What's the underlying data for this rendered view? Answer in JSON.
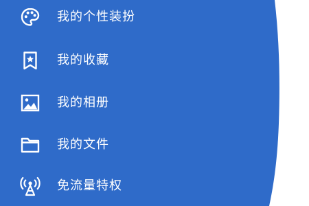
{
  "theme": {
    "drawer_color": "#2f6bc9",
    "background_color": "#ffffff",
    "text_color": "#ffffff"
  },
  "menu": {
    "items": [
      {
        "label": "我的个性装扮",
        "icon": "palette-icon"
      },
      {
        "label": "我的收藏",
        "icon": "bookmark-star-icon"
      },
      {
        "label": "我的相册",
        "icon": "image-icon"
      },
      {
        "label": "我的文件",
        "icon": "folder-icon"
      },
      {
        "label": "免流量特权",
        "icon": "broadcast-tower-icon"
      }
    ]
  }
}
